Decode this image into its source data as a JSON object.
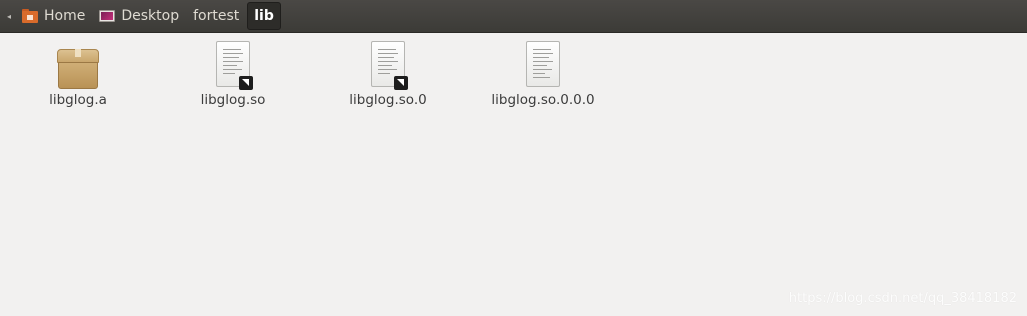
{
  "pathbar": {
    "crumbs": [
      {
        "label": "Home",
        "icon": "home-folder-icon"
      },
      {
        "label": "Desktop",
        "icon": "desktop-folder-icon"
      },
      {
        "label": "fortest"
      },
      {
        "label": "lib",
        "current": true
      }
    ]
  },
  "files": [
    {
      "name": "libglog.a",
      "icon": "package-icon"
    },
    {
      "name": "libglog.so",
      "icon": "symlink-text-file-icon"
    },
    {
      "name": "libglog.so.0",
      "icon": "symlink-text-file-icon"
    },
    {
      "name": "libglog.so.0.0.0",
      "icon": "text-file-icon"
    }
  ],
  "watermark": "https://blog.csdn.net/qq_38418182",
  "colors": {
    "pathbar_bg": "#3c3b37",
    "window_bg": "#f2f1f0",
    "home_folder": "#d96b2b"
  }
}
